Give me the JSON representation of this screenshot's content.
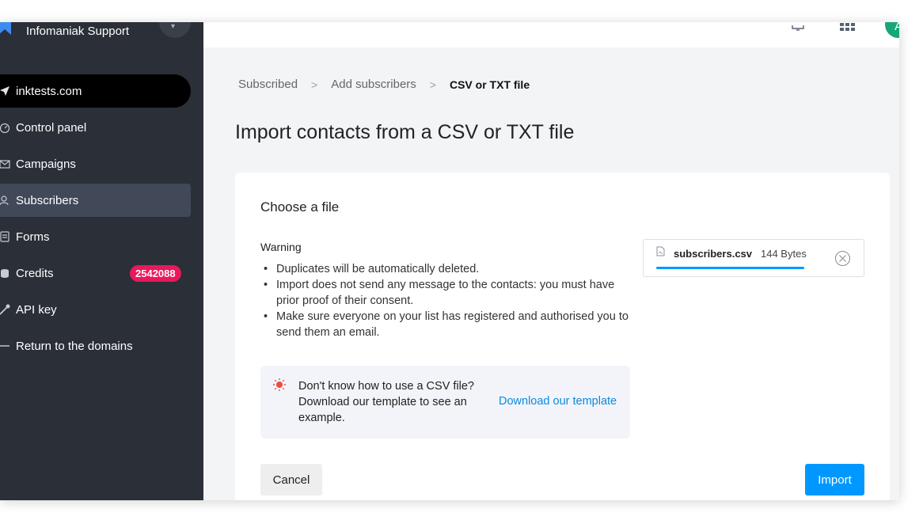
{
  "org": {
    "name": "Infomaniak Support",
    "chevron_icon": "chevron-down-icon"
  },
  "sidebar": {
    "items": [
      {
        "label": "inktests.com",
        "icon": "paper-plane-icon"
      },
      {
        "label": "Control panel",
        "icon": "dashboard-icon"
      },
      {
        "label": "Campaigns",
        "icon": "envelope-icon"
      },
      {
        "label": "Subscribers",
        "icon": "users-icon"
      },
      {
        "label": "Forms",
        "icon": "form-icon"
      },
      {
        "label": "Credits",
        "icon": "coins-icon",
        "badge": "2542088"
      },
      {
        "label": "API key",
        "icon": "key-icon"
      },
      {
        "label": "Return to the domains",
        "icon": "dash-icon"
      }
    ]
  },
  "topbar": {
    "icons": [
      "bell-icon",
      "apps-grid-icon"
    ],
    "avatar": "A"
  },
  "breadcrumb": {
    "items": [
      "Subscribed",
      "Add subscribers",
      "CSV or TXT file"
    ]
  },
  "page": {
    "title": "Import contacts from a CSV or TXT file"
  },
  "card": {
    "title": "Choose a file",
    "warning_title": "Warning",
    "warnings": [
      "Duplicates will be automatically deleted.",
      "Import does not send any message to the contacts: you must have prior proof of their consent.",
      "Make sure everyone on your list has registered and authorised you to send them an email."
    ],
    "file": {
      "name": "subscribers.csv",
      "size": "144 Bytes",
      "progress": 1.0
    },
    "tip": {
      "text": "Don't know how to use a CSV file? Download our template to see an example.",
      "link": "Download our template"
    },
    "cancel_label": "Cancel",
    "import_label": "Import"
  },
  "colors": {
    "accent": "#0098ff",
    "badge": "#e8195b",
    "sidebar": "#2a2f38"
  }
}
